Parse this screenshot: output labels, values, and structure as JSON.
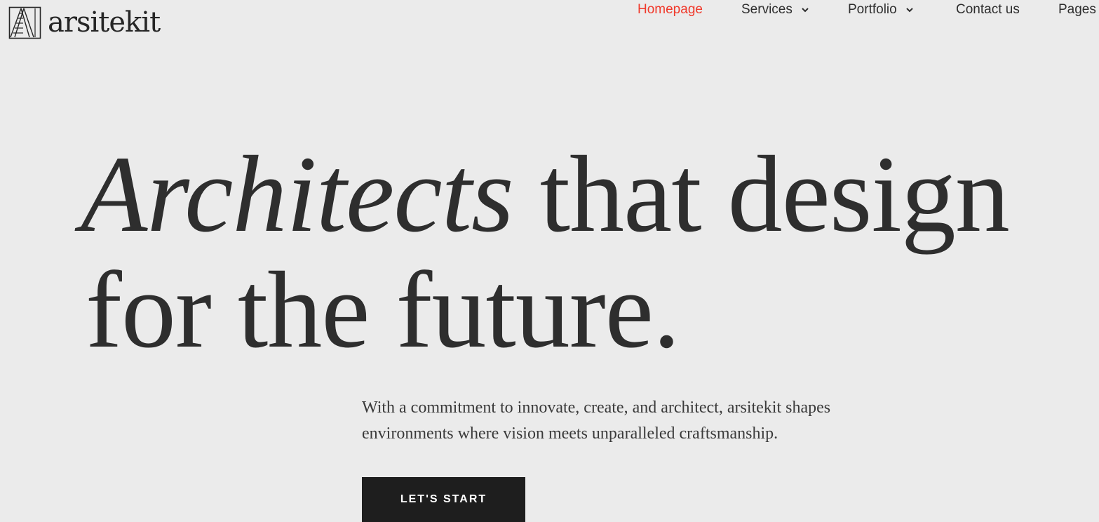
{
  "brand": {
    "name": "arsitekit",
    "icon": "ladder-frame-logo-icon"
  },
  "nav": {
    "items": [
      {
        "label": "Homepage",
        "active": true
      },
      {
        "label": "Services",
        "has_dropdown": true,
        "icon": "chevron-down-icon"
      },
      {
        "label": "Portfolio",
        "has_dropdown": true,
        "icon": "chevron-down-icon"
      },
      {
        "label": "Contact us"
      },
      {
        "label": "Pages"
      }
    ]
  },
  "hero": {
    "headline_italic": "Architects",
    "headline_rest": "that design",
    "headline_line2": "for the future.",
    "body_line1": "With a commitment to innovate, create, and architect, arsitekit shapes",
    "body_line2": "environments where vision meets unparalleled craftsmanship.",
    "cta_label": "LET'S START"
  },
  "colors": {
    "background": "#ebebeb",
    "text": "#2e2e2e",
    "accent": "#f0392b",
    "button_bg": "#1e1e1e",
    "button_text": "#ffffff"
  }
}
